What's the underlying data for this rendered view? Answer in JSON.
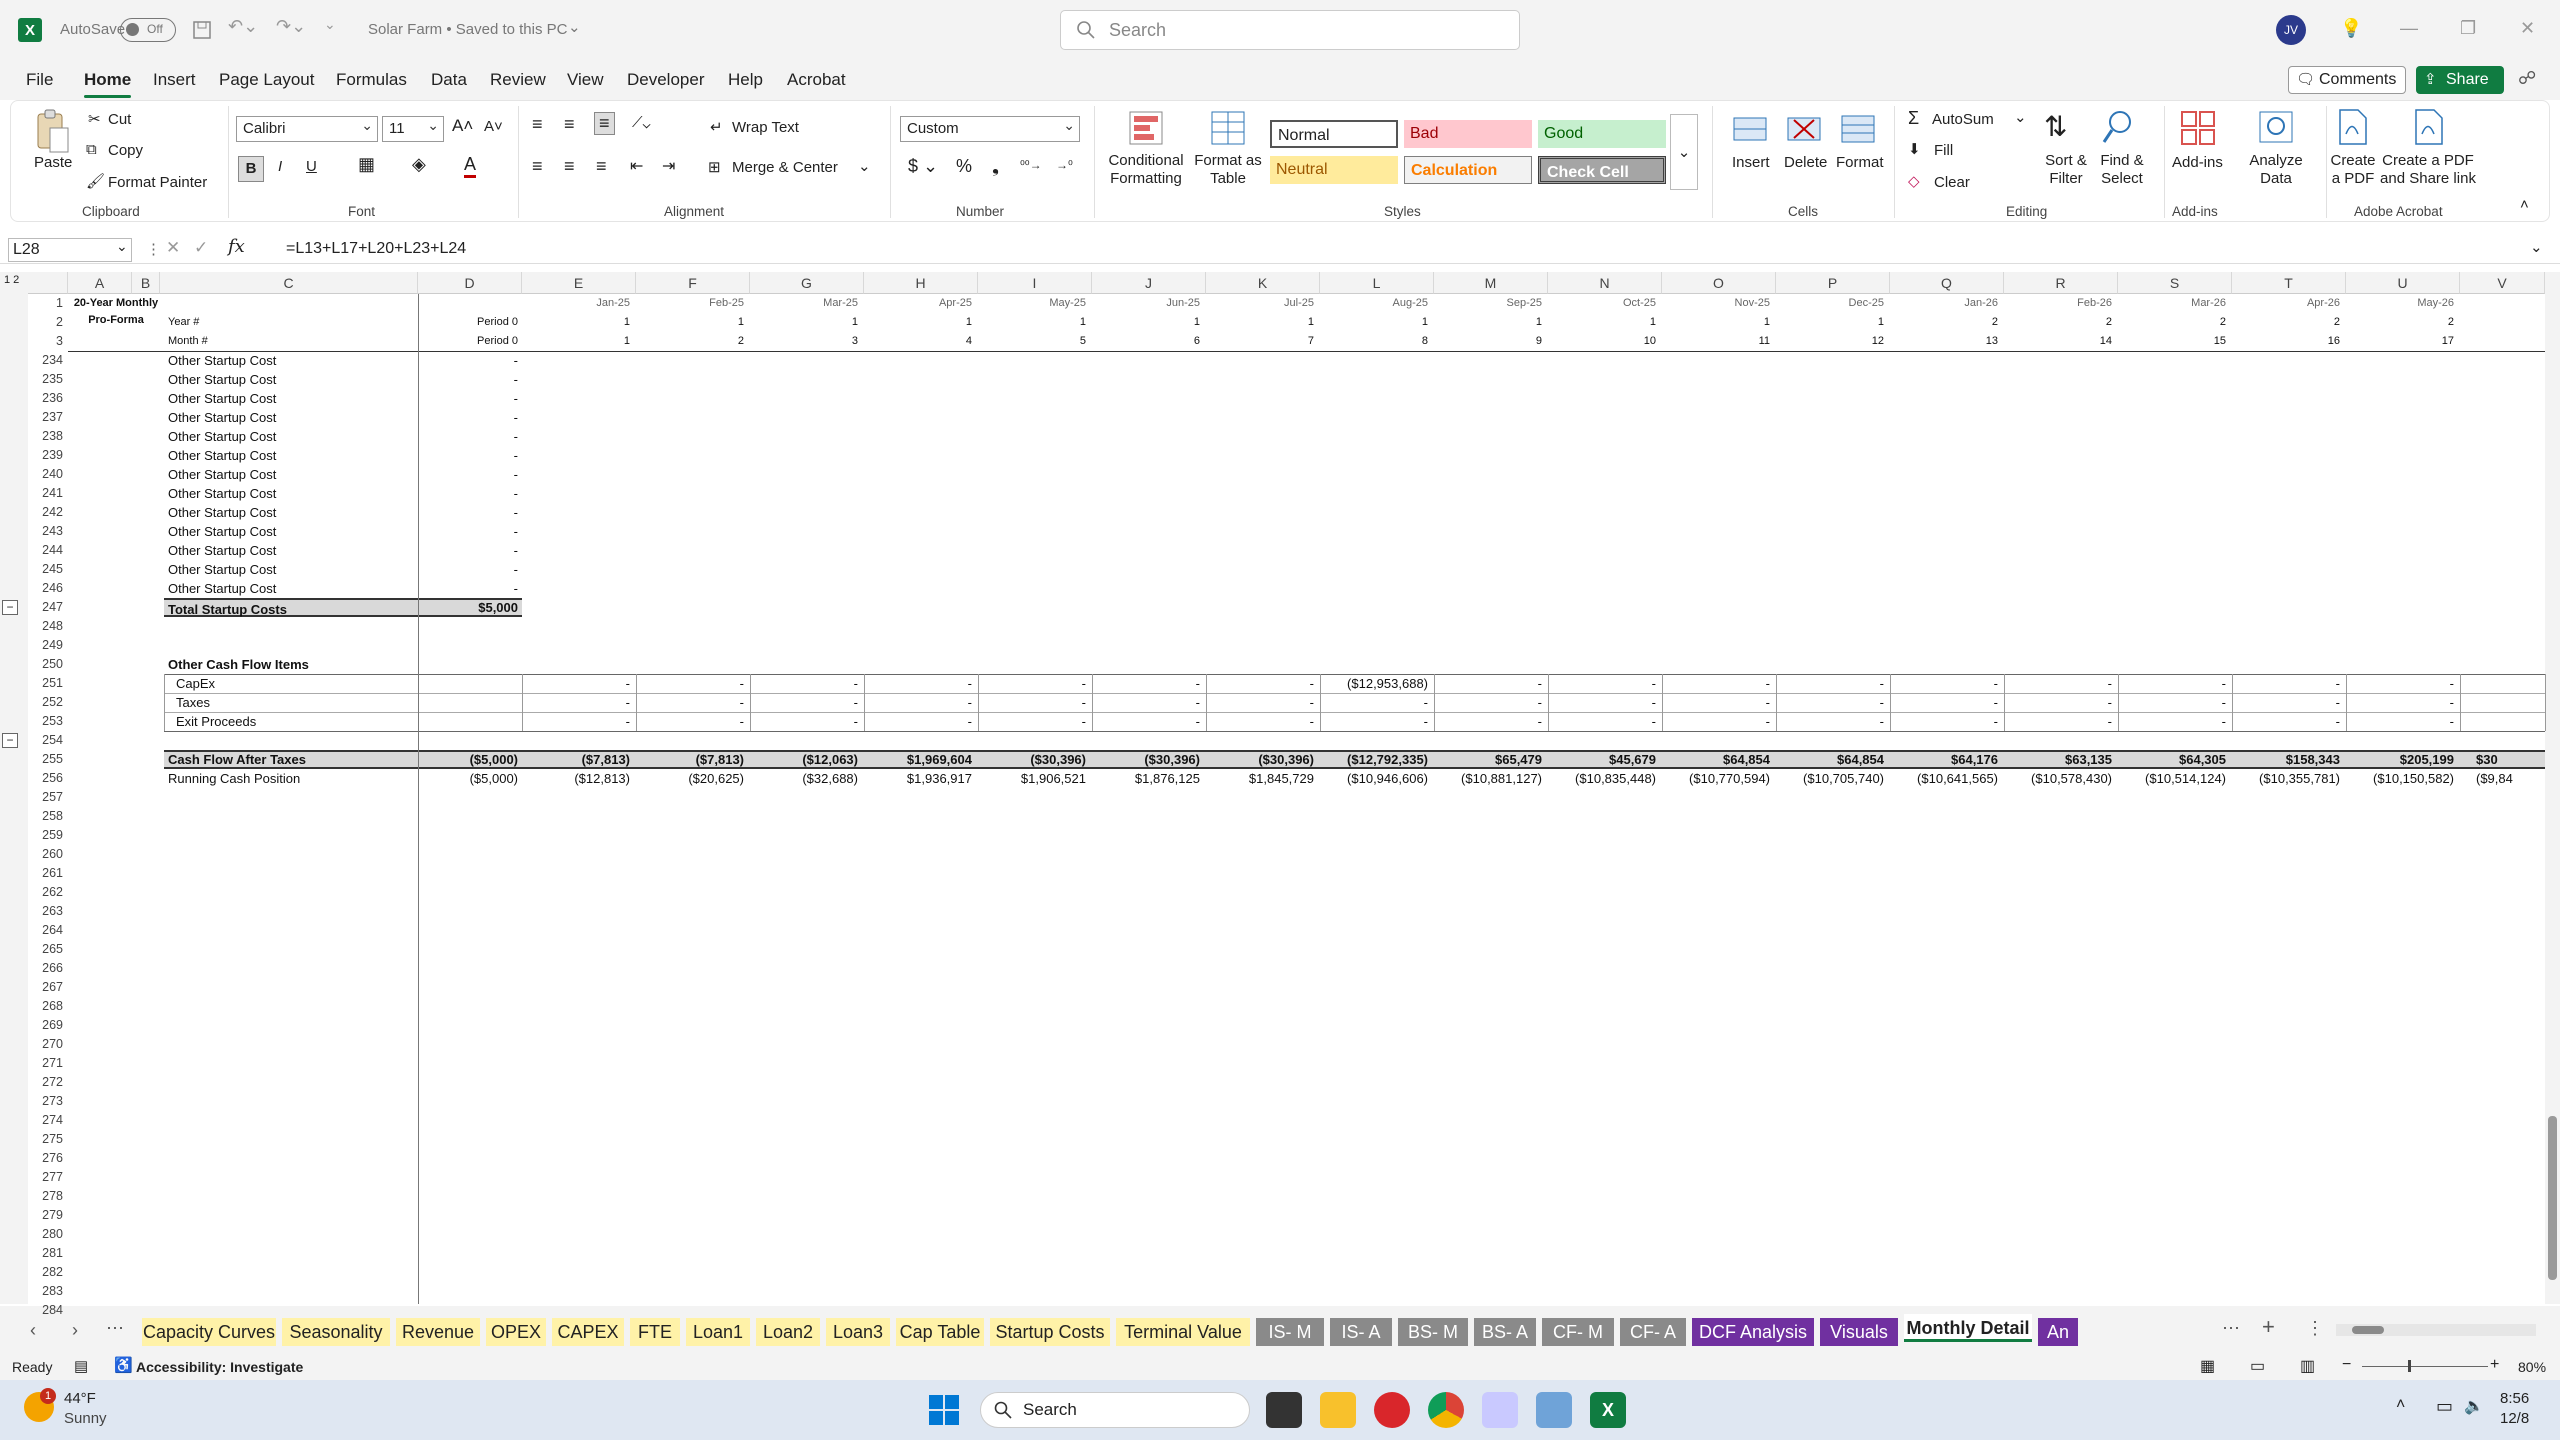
{
  "titlebar": {
    "autosave_label": "AutoSave",
    "autosave_state": "Off",
    "doc_title": "Solar Farm • Saved to this PC",
    "search_placeholder": "Search",
    "user_initials": "JV"
  },
  "menu": [
    "File",
    "Home",
    "Insert",
    "Page Layout",
    "Formulas",
    "Data",
    "Review",
    "View",
    "Developer",
    "Help",
    "Acrobat"
  ],
  "menu_active": "Home",
  "actions": {
    "comments": "Comments",
    "share": "Share"
  },
  "ribbon": {
    "clipboard": {
      "paste": "Paste",
      "cut": "Cut",
      "copy": "Copy",
      "format_painter": "Format Painter",
      "group": "Clipboard"
    },
    "font": {
      "name": "Calibri",
      "size": "11",
      "group": "Font"
    },
    "alignment": {
      "wrap": "Wrap Text",
      "merge": "Merge & Center",
      "group": "Alignment"
    },
    "number": {
      "format": "Custom",
      "group": "Number"
    },
    "styles": {
      "cond_fmt": "Conditional Formatting",
      "format_table": "Format as Table",
      "normal": "Normal",
      "bad": "Bad",
      "good": "Good",
      "neutral": "Neutral",
      "calculation": "Calculation",
      "check_cell": "Check Cell",
      "group": "Styles"
    },
    "cells": {
      "insert": "Insert",
      "delete": "Delete",
      "format": "Format",
      "group": "Cells"
    },
    "editing": {
      "autosum": "AutoSum",
      "fill": "Fill",
      "clear": "Clear",
      "sort": "Sort & Filter",
      "find": "Find & Select",
      "group": "Editing"
    },
    "addins": {
      "addins": "Add-ins",
      "analyze": "Analyze Data",
      "group": "Add-ins"
    },
    "acrobat": {
      "create_pdf": "Create a PDF",
      "share_pdf": "Create a PDF and Share link",
      "group": "Adobe Acrobat"
    }
  },
  "formula_bar": {
    "name_box": "L28",
    "formula": "=L13+L17+L20+L23+L24"
  },
  "columns": [
    "A",
    "B",
    "C",
    "D",
    "E",
    "F",
    "G",
    "H",
    "I",
    "J",
    "K",
    "L",
    "M",
    "N",
    "O",
    "P",
    "Q",
    "R",
    "S",
    "T",
    "U",
    "V"
  ],
  "header_block": {
    "title1": "20-Year Monthly",
    "title2": "Pro-Forma",
    "year_label": "Year #",
    "month_label": "Month #",
    "period0": "Period 0",
    "dates": [
      "Jan-25",
      "Feb-25",
      "Mar-25",
      "Apr-25",
      "May-25",
      "Jun-25",
      "Jul-25",
      "Aug-25",
      "Sep-25",
      "Oct-25",
      "Nov-25",
      "Dec-25",
      "Jan-26",
      "Feb-26",
      "Mar-26",
      "Apr-26",
      "May-26"
    ],
    "years": [
      "1",
      "1",
      "1",
      "1",
      "1",
      "1",
      "1",
      "1",
      "1",
      "1",
      "1",
      "1",
      "2",
      "2",
      "2",
      "2",
      "2"
    ],
    "months": [
      "1",
      "2",
      "3",
      "4",
      "5",
      "6",
      "7",
      "8",
      "9",
      "10",
      "11",
      "12",
      "13",
      "14",
      "15",
      "16",
      "17"
    ]
  },
  "header_rows": [
    "1",
    "2",
    "3"
  ],
  "startup_rows": [
    {
      "row": "234",
      "label": "Other Startup Cost",
      "d": "-"
    },
    {
      "row": "235",
      "label": "Other Startup Cost",
      "d": "-"
    },
    {
      "row": "236",
      "label": "Other Startup Cost",
      "d": "-"
    },
    {
      "row": "237",
      "label": "Other Startup Cost",
      "d": "-"
    },
    {
      "row": "238",
      "label": "Other Startup Cost",
      "d": "-"
    },
    {
      "row": "239",
      "label": "Other Startup Cost",
      "d": "-"
    },
    {
      "row": "240",
      "label": "Other Startup Cost",
      "d": "-"
    },
    {
      "row": "241",
      "label": "Other Startup Cost",
      "d": "-"
    },
    {
      "row": "242",
      "label": "Other Startup Cost",
      "d": "-"
    },
    {
      "row": "243",
      "label": "Other Startup Cost",
      "d": "-"
    },
    {
      "row": "244",
      "label": "Other Startup Cost",
      "d": "-"
    },
    {
      "row": "245",
      "label": "Other Startup Cost",
      "d": "-"
    },
    {
      "row": "246",
      "label": "Other Startup Cost",
      "d": "-"
    }
  ],
  "total_startup": {
    "row": "247",
    "label": "Total Startup Costs",
    "d": "$5,000"
  },
  "other_cf_title": "Other Cash Flow Items",
  "other_cf": [
    {
      "row": "251",
      "label": "CapEx",
      "values": [
        "-",
        "-",
        "-",
        "-",
        "-",
        "-",
        "-",
        "($12,953,688)",
        "-",
        "-",
        "-",
        "-",
        "-",
        "-",
        "-",
        "-",
        "-"
      ]
    },
    {
      "row": "252",
      "label": "Taxes",
      "values": [
        "-",
        "-",
        "-",
        "-",
        "-",
        "-",
        "-",
        "-",
        "-",
        "-",
        "-",
        "-",
        "-",
        "-",
        "-",
        "-",
        "-"
      ]
    },
    {
      "row": "253",
      "label": "Exit Proceeds",
      "values": [
        "-",
        "-",
        "-",
        "-",
        "-",
        "-",
        "-",
        "-",
        "-",
        "-",
        "-",
        "-",
        "-",
        "-",
        "-",
        "-",
        "-"
      ]
    }
  ],
  "cf_after_tax": {
    "row": "255",
    "label": "Cash Flow After Taxes",
    "d": "($5,000)",
    "values": [
      "($7,813)",
      "($7,813)",
      "($12,063)",
      "$1,969,604",
      "($30,396)",
      "($30,396)",
      "($30,396)",
      "($12,792,335)",
      "$65,479",
      "$45,679",
      "$64,854",
      "$64,854",
      "$64,176",
      "$63,135",
      "$64,305",
      "$158,343",
      "$205,199",
      "$30"
    ]
  },
  "running_cash": {
    "row": "256",
    "label": "Running Cash Position",
    "d": "($5,000)",
    "values": [
      "($12,813)",
      "($20,625)",
      "($32,688)",
      "$1,936,917",
      "$1,906,521",
      "$1,876,125",
      "$1,845,729",
      "($10,946,606)",
      "($10,881,127)",
      "($10,835,448)",
      "($10,770,594)",
      "($10,705,740)",
      "($10,641,565)",
      "($10,578,430)",
      "($10,514,124)",
      "($10,355,781)",
      "($10,150,582)",
      "($9,84"
    ]
  },
  "blank_rows": [
    "248",
    "249",
    "250",
    "254",
    "257",
    "258",
    "259",
    "260",
    "261",
    "262",
    "263",
    "264",
    "265",
    "266",
    "267",
    "268",
    "269",
    "270",
    "271",
    "272",
    "273",
    "274",
    "275",
    "276",
    "277",
    "278",
    "279",
    "280",
    "281",
    "282",
    "283",
    "284"
  ],
  "sheet_tabs": [
    {
      "label": "Capacity Curves",
      "color": "#fff2a8"
    },
    {
      "label": "Seasonality",
      "color": "#fff2a8"
    },
    {
      "label": "Revenue",
      "color": "#fff2a8"
    },
    {
      "label": "OPEX",
      "color": "#fff2a8"
    },
    {
      "label": "CAPEX",
      "color": "#fff2a8"
    },
    {
      "label": "FTE",
      "color": "#fff2a8"
    },
    {
      "label": "Loan1",
      "color": "#fff2a8"
    },
    {
      "label": "Loan2",
      "color": "#fff2a8"
    },
    {
      "label": "Loan3",
      "color": "#fff2a8"
    },
    {
      "label": "Cap Table",
      "color": "#fff2a8"
    },
    {
      "label": "Startup Costs",
      "color": "#fff2a8"
    },
    {
      "label": "Terminal Value",
      "color": "#fff2a8"
    },
    {
      "label": "IS- M",
      "color": "#8a8a8a"
    },
    {
      "label": "IS- A",
      "color": "#8a8a8a"
    },
    {
      "label": "BS- M",
      "color": "#8a8a8a"
    },
    {
      "label": "BS- A",
      "color": "#8a8a8a"
    },
    {
      "label": "CF- M",
      "color": "#8a8a8a"
    },
    {
      "label": "CF- A",
      "color": "#8a8a8a"
    },
    {
      "label": "DCF Analysis",
      "color": "#7030a0"
    },
    {
      "label": "Visuals",
      "color": "#7030a0"
    },
    {
      "label": "Monthly Detail",
      "color": "#ffffff"
    },
    {
      "label": "An",
      "color": "#7030a0"
    }
  ],
  "status": {
    "ready": "Ready",
    "accessibility": "Accessibility: Investigate",
    "zoom": "80%"
  },
  "taskbar": {
    "temp": "44°F",
    "weather": "Sunny",
    "search": "Search",
    "time": "8:56",
    "date": "12/8",
    "badge": "1"
  }
}
